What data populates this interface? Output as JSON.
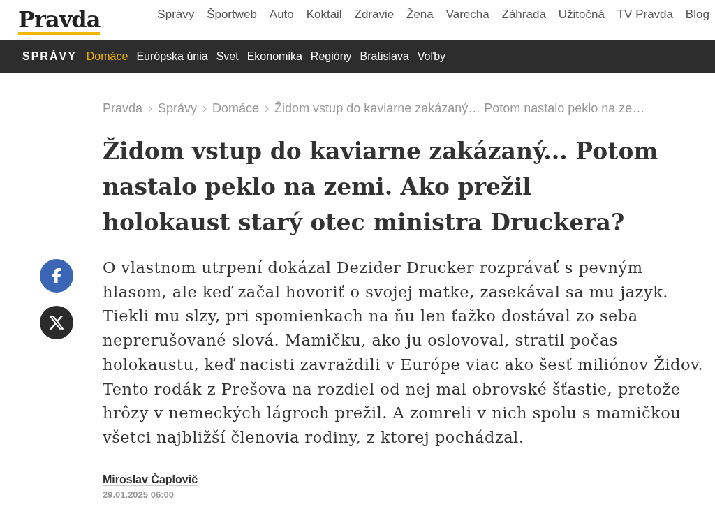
{
  "header": {
    "logo": "Pravda",
    "nav": [
      "Správy",
      "Športweb",
      "Auto",
      "Koktail",
      "Zdravie",
      "Žena",
      "Varecha",
      "Záhrada",
      "Užitočná",
      "TV Pravda",
      "Blog"
    ]
  },
  "section_bar": {
    "title": "SPRÁVY",
    "items": [
      {
        "label": "Domáce",
        "selected": true
      },
      {
        "label": "Európska únia",
        "selected": false
      },
      {
        "label": "Svet",
        "selected": false
      },
      {
        "label": "Ekonomika",
        "selected": false
      },
      {
        "label": "Regióny",
        "selected": false
      },
      {
        "label": "Bratislava",
        "selected": false
      },
      {
        "label": "Voľby",
        "selected": false
      }
    ]
  },
  "breadcrumb": [
    "Pravda",
    "Správy",
    "Domáce",
    "Židom vstup do kaviarne zakázaný… Potom nastalo peklo na ze…"
  ],
  "article": {
    "headline": "Židom vstup do kaviarne zakázaný... Potom nastalo peklo na zemi. Ako prežil holokaust starý otec ministra Druckera?",
    "share": [
      {
        "kind": "facebook",
        "color": "#3b66b5"
      },
      {
        "kind": "x",
        "color": "#2b2b2b"
      }
    ],
    "perex": "O vlastnom utrpení dokázal Dezider Drucker rozprávať s pevným hlasom, ale keď začal hovoriť o svojej matke, zasekával sa mu jazyk. Tiekli mu slzy, pri spomienkach na ňu len ťažko dostával zo seba neprerušované slová. Mamičku, ako ju oslovoval, stratil počas holokaustu, keď nacisti zavraždili v Európe viac ako šesť miliónov Židov. Tento rodák z Prešova na rozdiel od nej mal obrovské šťastie, pretože hrôzy v nemeckých lágroch prežil. A zomreli v nich spolu s mamičkou všetci najbližší členovia rodiny, z ktorej pochádzal.",
    "author": "Miroslav Čaplovič",
    "date": "29.01.2025 06:00"
  }
}
